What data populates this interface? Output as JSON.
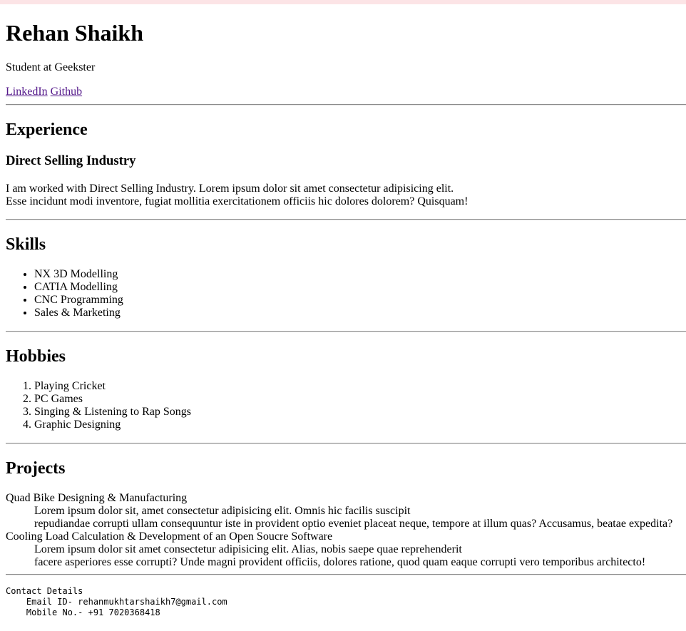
{
  "header": {
    "name": "Rehan Shaikh",
    "subtitle": "Student at Geekster",
    "links": [
      {
        "label": "LinkedIn"
      },
      {
        "label": "Github"
      }
    ]
  },
  "experience": {
    "heading": "Experience",
    "role": "Direct Selling Industry",
    "text_line1": "I am worked with Direct Selling Industry. Lorem ipsum dolor sit amet consectetur adipisicing elit.",
    "text_line2": "Esse incidunt modi inventore, fugiat mollitia exercitationem officiis hic dolores dolorem? Quisquam!"
  },
  "skills": {
    "heading": "Skills",
    "items": [
      "NX 3D Modelling",
      "CATIA Modelling",
      "CNC Programming",
      "Sales & Marketing"
    ]
  },
  "hobbies": {
    "heading": "Hobbies",
    "items": [
      "Playing Cricket",
      "PC Games",
      "Singing & Listening to Rap Songs",
      "Graphic Designing"
    ]
  },
  "projects": {
    "heading": "Projects",
    "items": [
      {
        "title": "Quad Bike Designing & Manufacturing",
        "line1": "Lorem ipsum dolor sit, amet consectetur adipisicing elit. Omnis hic facilis suscipit",
        "line2": "repudiandae corrupti ullam consequuntur iste in provident optio eveniet placeat neque, tempore at illum quas? Accusamus, beatae expedita?"
      },
      {
        "title": "Cooling Load Calculation & Development of an Open Soucre Software",
        "line1": "Lorem ipsum dolor sit amet consectetur adipisicing elit. Alias, nobis saepe quae reprehenderit",
        "line2": "facere asperiores esse corrupti? Unde magni provident officiis, dolores ratione, quod quam eaque corrupti vero temporibus architecto!"
      }
    ]
  },
  "contact": {
    "heading": "Contact Details",
    "email": "    Email ID- rehanmukhtarshaikh7@gmail.com",
    "mobile": "    Mobile No.- +91 7020368418"
  },
  "colors": {
    "top_bar": "#fce4e6",
    "link_visited": "#551a8b"
  }
}
